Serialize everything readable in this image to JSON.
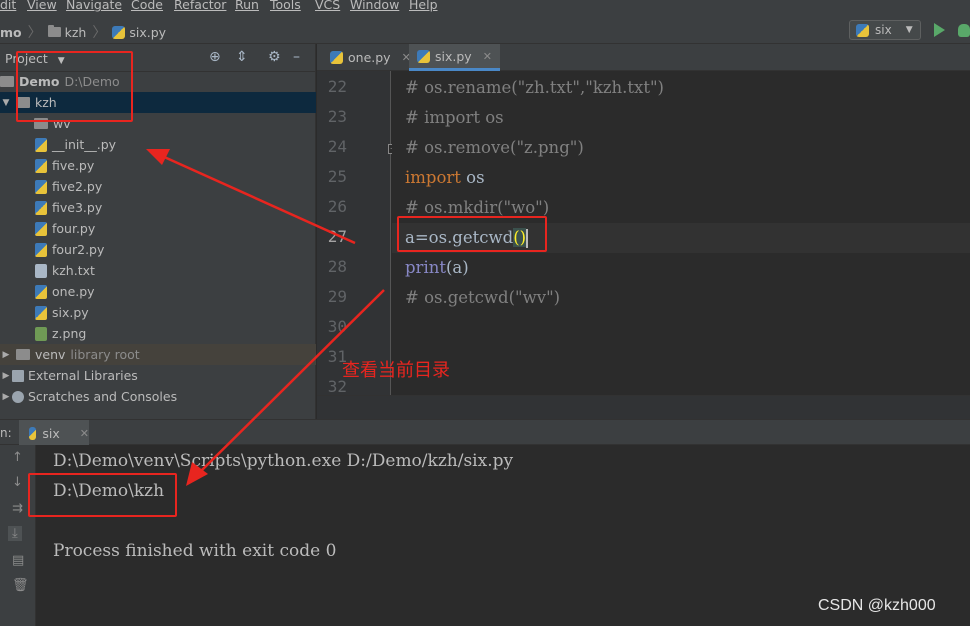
{
  "menu": [
    "dit",
    "View",
    "Navigate",
    "Code",
    "Refactor",
    "Run",
    "Tools",
    "VCS",
    "Window",
    "Help"
  ],
  "breadcrumb": {
    "project": "mo",
    "folder": "kzh",
    "file": "six.py"
  },
  "run_config": {
    "name": "six"
  },
  "project_panel": {
    "title": "Project",
    "root": {
      "name": "Demo",
      "path": "D:\\Demo"
    },
    "items": [
      {
        "label": "kzh",
        "kind": "folder"
      },
      {
        "label": "wv",
        "kind": "folder"
      },
      {
        "label": "__init__.py",
        "kind": "py"
      },
      {
        "label": "five.py",
        "kind": "py"
      },
      {
        "label": "five2.py",
        "kind": "py"
      },
      {
        "label": "five3.py",
        "kind": "py"
      },
      {
        "label": "four.py",
        "kind": "py"
      },
      {
        "label": "four2.py",
        "kind": "py"
      },
      {
        "label": "kzh.txt",
        "kind": "txt"
      },
      {
        "label": "one.py",
        "kind": "py"
      },
      {
        "label": "six.py",
        "kind": "py"
      },
      {
        "label": "z.png",
        "kind": "png"
      }
    ],
    "venv": {
      "label": "venv",
      "note": "library root"
    },
    "external": "External Libraries",
    "scratches": "Scratches and Consoles"
  },
  "editor": {
    "tabs": [
      "one.py",
      "six.py"
    ],
    "line_numbers": [
      "22",
      "23",
      "24",
      "25",
      "26",
      "27",
      "28",
      "29",
      "30",
      "31",
      "32"
    ],
    "lines": {
      "l22": "# os.rename(\"zh.txt\",\"kzh.txt\")",
      "l23": "# import os",
      "l24": "# os.remove(\"z.png\")",
      "l25_kw": "import",
      "l25_rest": " os",
      "l26": "# os.mkdir(\"wo\")",
      "l27_pre": "a=os.getcwd",
      "l27_paren": "()",
      "l28_bi": "print",
      "l28_rest": "(a)",
      "l29": "# os.getcwd(\"wv\")"
    }
  },
  "run_panel": {
    "label": "n:",
    "tab": "six",
    "output": [
      "D:\\Demo\\venv\\Scripts\\python.exe D:/Demo/kzh/six.py",
      "D:\\Demo\\kzh",
      "",
      "Process finished with exit code 0"
    ]
  },
  "annotation": {
    "text": "查看当前目录",
    "color": "#e8251f"
  },
  "watermark": "CSDN @kzh000"
}
